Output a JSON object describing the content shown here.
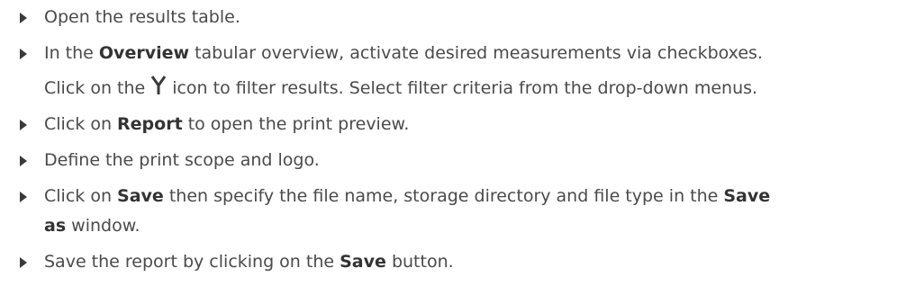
{
  "steps": [
    {
      "text": "Open the results table."
    },
    {
      "line1": {
        "before": "In the ",
        "bold": "Overview",
        "after": " tabular overview, activate desired measurements via checkboxes."
      },
      "line2": {
        "before": "Click on the",
        "icon": "filter-icon",
        "after": "icon to filter results. Select filter criteria from the drop-down menus."
      }
    },
    {
      "before": "Click on ",
      "bold": "Report",
      "after": " to open the print preview."
    },
    {
      "text": "Define the print scope and logo."
    },
    {
      "before": "Click on ",
      "bold1": "Save",
      "middle": " then specify the file name, storage directory and file type in the ",
      "bold2a": "Save",
      "bold2b": "as",
      "after": " window."
    },
    {
      "before": "Save the report by clicking on the ",
      "bold": "Save",
      "after": " button."
    }
  ]
}
